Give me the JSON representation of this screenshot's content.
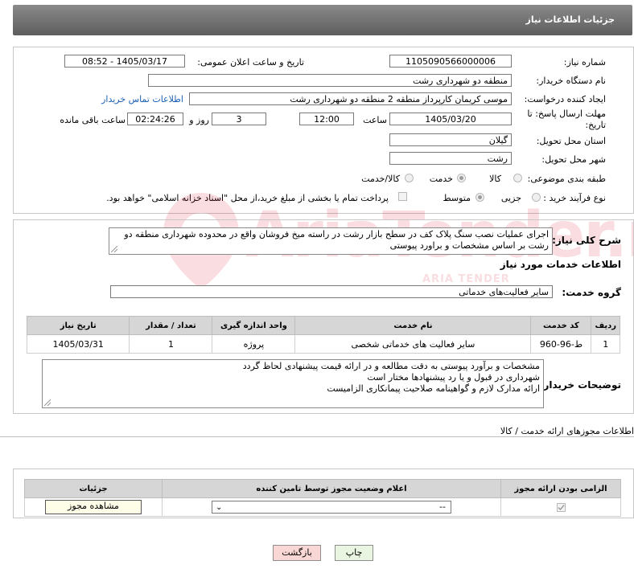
{
  "header": {
    "title": "جزئیات اطلاعات نیاز"
  },
  "form": {
    "need_number_label": "شماره نیاز:",
    "need_number": "1105090566000006",
    "announce_label": "تاریخ و ساعت اعلان عمومی:",
    "announce_value": "1405/03/17 - 08:52",
    "buyer_org_label": "نام دستگاه خریدار:",
    "buyer_org": "منطقه دو شهرداری رشت",
    "requester_label": "ایجاد کننده درخواست:",
    "requester": "موسی کریمان کارپرداز منطقه 2 منطقه دو شهرداری رشت",
    "buyer_contact_link": "اطلاعات تماس خریدار",
    "deadline_label": "مهلت ارسال پاسخ: تا تاریخ:",
    "deadline_date": "1405/03/20",
    "time_label": "ساعت",
    "deadline_time": "12:00",
    "days_value": "3",
    "days_label": "روز و",
    "remaining_value": "02:24:26",
    "remaining_label": "ساعت باقی مانده",
    "province_label": "استان محل تحویل:",
    "province": "گیلان",
    "city_label": "شهر محل تحویل:",
    "city": "رشت",
    "category_label": "طبقه بندی موضوعی:",
    "category_options": [
      "کالا",
      "خدمت",
      "کالا/خدمت"
    ],
    "category_selected": "خدمت",
    "process_label": "نوع فرآیند خرید :",
    "process_options": [
      "جزیی",
      "متوسط"
    ],
    "process_selected": "متوسط",
    "payment_note": "پرداخت تمام یا بخشی از مبلغ خرید،از محل \"اسناد خزانه اسلامی\" خواهد بود."
  },
  "description": {
    "label": "شرح کلی نیاز:",
    "text": "اجرای عملیات نصب سنگ پلاک کف در سطح بازار رشت در راسته میخ فروشان واقع در محدوده شهرداری منطقه دو رشت بر اساس مشخصات و براورد پیوستی"
  },
  "services": {
    "section_title": "اطلاعات خدمات مورد نیاز",
    "group_label": "گروه خدمت:",
    "group_value": "سایر فعالیت‌های خدماتی",
    "columns": [
      "ردیف",
      "کد خدمت",
      "نام خدمت",
      "واحد اندازه گیری",
      "تعداد / مقدار",
      "تاریخ نیاز"
    ],
    "rows": [
      {
        "row": "1",
        "code": "ط-96-960",
        "name": "سایر فعالیت های خدماتی شخصی",
        "unit": "پروژه",
        "qty": "1",
        "date": "1405/03/31"
      }
    ]
  },
  "buyer_notes": {
    "label": "توضیحات خریدار:",
    "lines": [
      "مشخصات و برآورد پیوستی به دقت مطالعه و در ارائه قیمت پیشنهادی لحاظ گردد",
      "شهرداری در قبول و یا رد پیشنهادها مختار است",
      "ارائه مدارک لازم و گواهینامه صلاحیت پیمانکاری الزامیست"
    ]
  },
  "permits": {
    "section_title": "اطلاعات مجوزهای ارائه خدمت / کالا",
    "columns": [
      "الزامی بودن ارائه مجوز",
      "اعلام وضعیت مجوز توسط تامین کننده",
      "جزئیات"
    ],
    "select_value": "--",
    "view_button": "مشاهده مجوز"
  },
  "footer": {
    "print_button": "چاپ",
    "back_button": "بازگشت"
  },
  "watermark": {
    "text": "AriaTender.neT",
    "sub": "ARIA TENDER"
  }
}
